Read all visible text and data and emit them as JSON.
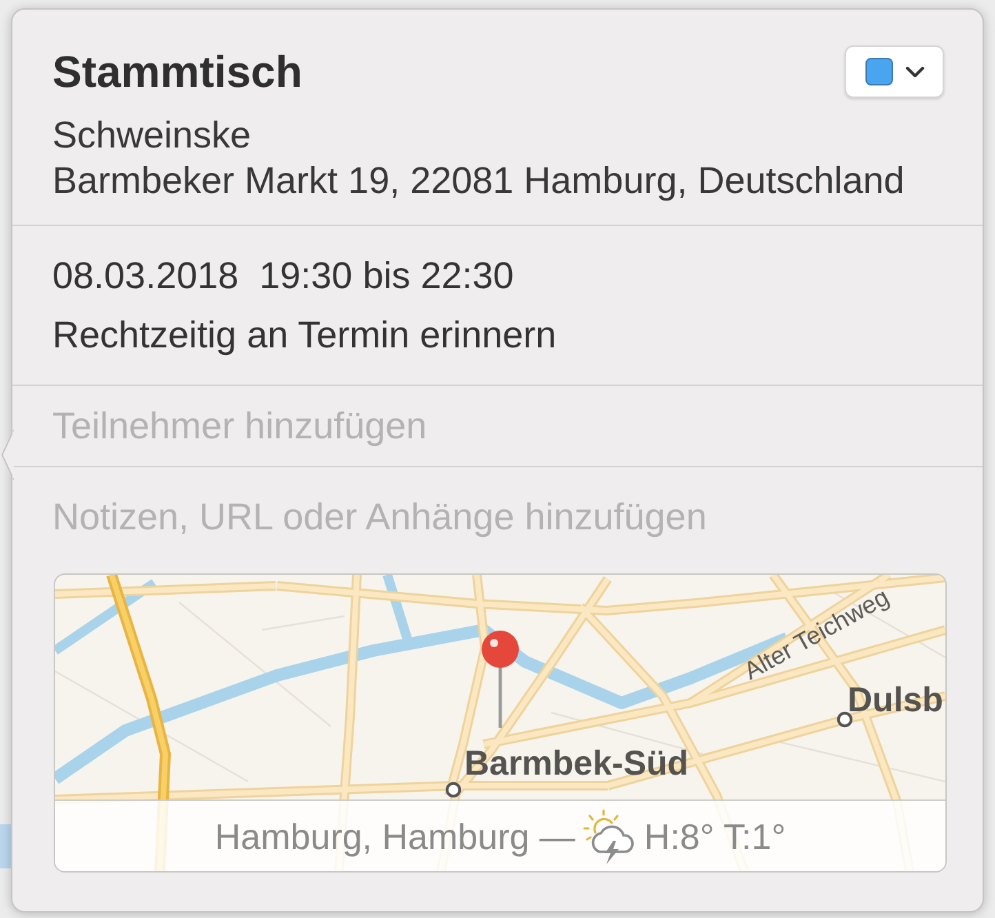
{
  "title": "Stammtisch",
  "calendar_picker": {
    "color": "#4aa5f0"
  },
  "location": {
    "name": "Schweinske",
    "address": "Barmbeker Markt 19, 22081 Hamburg, Deutschland"
  },
  "schedule": {
    "date_time": "08.03.2018  19:30 bis 22:30",
    "alert": "Rechtzeitig an Termin erinnern"
  },
  "invitees": {
    "placeholder": "Teilnehmer hinzufügen"
  },
  "notes": {
    "placeholder": "Notizen, URL oder Anhänge hinzufügen"
  },
  "map": {
    "labels": [
      {
        "text": "Alter Teichweg",
        "kind": "street"
      },
      {
        "text": "Dulsb",
        "kind": "district"
      },
      {
        "text": "Barmbek-Süd",
        "kind": "district"
      }
    ],
    "weather": {
      "place": "Hamburg, Hamburg —",
      "forecast": "H:8° T:1°"
    }
  }
}
